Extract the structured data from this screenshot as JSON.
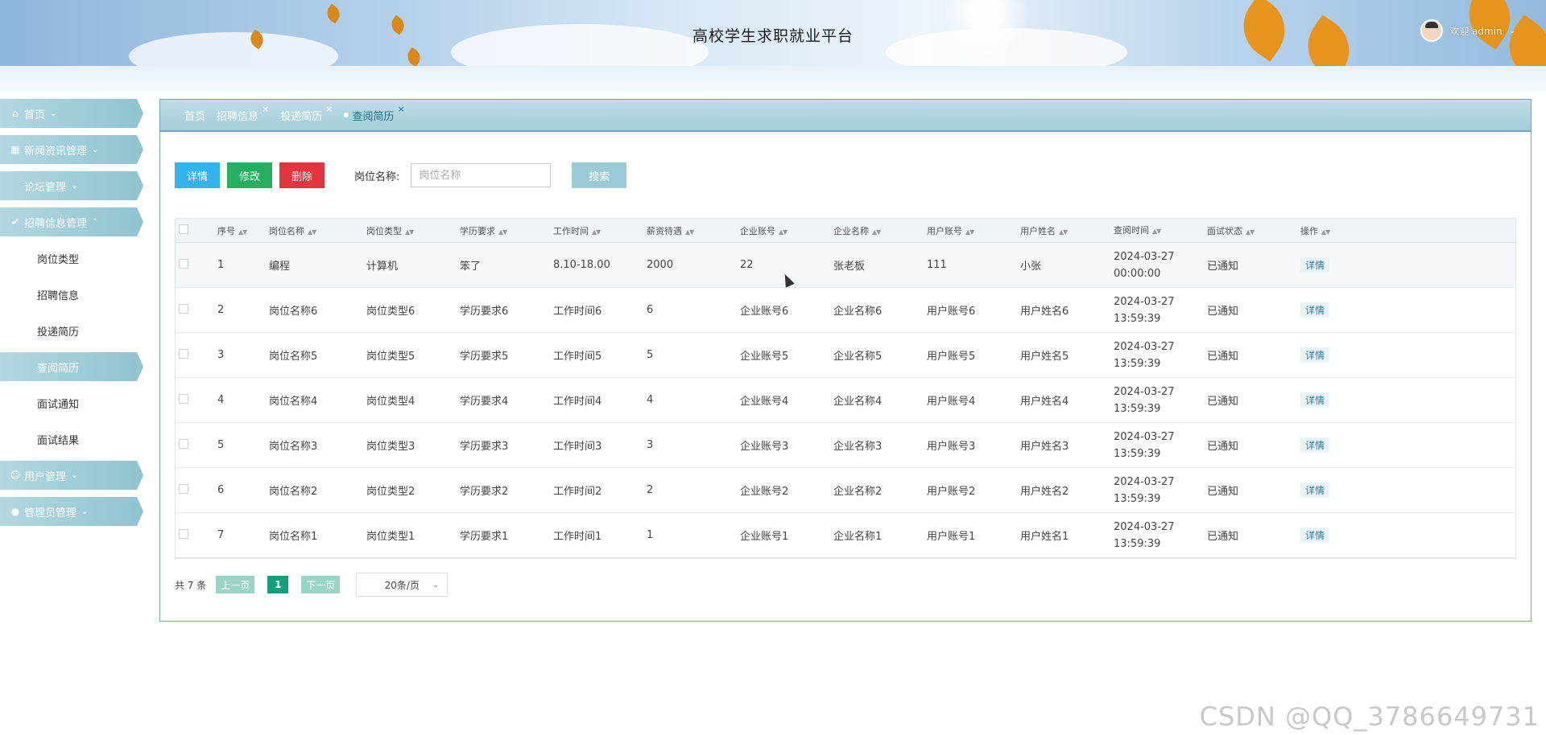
{
  "header": {
    "title": "高校学生求职就业平台",
    "user_label": "欢迎 admin"
  },
  "sidebar": {
    "items": [
      {
        "label": "首页",
        "icon": "home-icon"
      },
      {
        "label": "新闻资讯管理",
        "icon": "grid-icon"
      },
      {
        "label": "论坛管理",
        "icon": ""
      },
      {
        "label": "招聘信息管理",
        "icon": "check-circle-icon"
      }
    ],
    "submenu": [
      "岗位类型",
      "招聘信息",
      "投递简历",
      "查阅简历",
      "面试通知",
      "面试结果"
    ],
    "active_submenu": "查阅简历",
    "bottom_items": [
      {
        "label": "用户管理",
        "icon": "user-icon"
      },
      {
        "label": "管理员管理",
        "icon": "admin-icon"
      }
    ]
  },
  "tabs": [
    {
      "label": "首页",
      "closable": false
    },
    {
      "label": "招聘信息",
      "closable": true
    },
    {
      "label": "投递简历",
      "closable": true
    },
    {
      "label": "查阅简历",
      "closable": true,
      "active": true
    }
  ],
  "toolbar": {
    "detail_label": "详情",
    "edit_label": "修改",
    "delete_label": "删除",
    "search_label": "岗位名称:",
    "search_placeholder": "岗位名称",
    "search_button": "搜索"
  },
  "table": {
    "columns": [
      "序号",
      "岗位名称",
      "岗位类型",
      "学历要求",
      "工作时间",
      "薪资待遇",
      "企业账号",
      "企业名称",
      "用户账号",
      "用户姓名",
      "查阅时间",
      "面试状态",
      "操作"
    ],
    "rows": [
      [
        "1",
        "编程",
        "计算机",
        "笨了",
        "8.10-18.00",
        "2000",
        "22",
        "张老板",
        "111",
        "小张",
        "2024-03-27 00:00:00",
        "已通知",
        "详情"
      ],
      [
        "2",
        "岗位名称6",
        "岗位类型6",
        "学历要求6",
        "工作时间6",
        "6",
        "企业账号6",
        "企业名称6",
        "用户账号6",
        "用户姓名6",
        "2024-03-27 13:59:39",
        "已通知",
        "详情"
      ],
      [
        "3",
        "岗位名称5",
        "岗位类型5",
        "学历要求5",
        "工作时间5",
        "5",
        "企业账号5",
        "企业名称5",
        "用户账号5",
        "用户姓名5",
        "2024-03-27 13:59:39",
        "已通知",
        "详情"
      ],
      [
        "4",
        "岗位名称4",
        "岗位类型4",
        "学历要求4",
        "工作时间4",
        "4",
        "企业账号4",
        "企业名称4",
        "用户账号4",
        "用户姓名4",
        "2024-03-27 13:59:39",
        "已通知",
        "详情"
      ],
      [
        "5",
        "岗位名称3",
        "岗位类型3",
        "学历要求3",
        "工作时间3",
        "3",
        "企业账号3",
        "企业名称3",
        "用户账号3",
        "用户姓名3",
        "2024-03-27 13:59:39",
        "已通知",
        "详情"
      ],
      [
        "6",
        "岗位名称2",
        "岗位类型2",
        "学历要求2",
        "工作时间2",
        "2",
        "企业账号2",
        "企业名称2",
        "用户账号2",
        "用户姓名2",
        "2024-03-27 13:59:39",
        "已通知",
        "详情"
      ],
      [
        "7",
        "岗位名称1",
        "岗位类型1",
        "学历要求1",
        "工作时间1",
        "1",
        "企业账号1",
        "企业名称1",
        "用户账号1",
        "用户姓名1",
        "2024-03-27 13:59:39",
        "已通知",
        "详情"
      ]
    ]
  },
  "pagination": {
    "total": "共 7 条",
    "prev": "上一页",
    "current": "1",
    "next": "下一页",
    "page_size": "20条/页"
  },
  "watermark": "CSDN @QQ_3786649731",
  "colors": {
    "accent_teal": "#8ec4d1",
    "detail": "#34b4ec",
    "edit": "#27ae60",
    "delete": "#e5333f",
    "page_active": "#12a07c"
  }
}
